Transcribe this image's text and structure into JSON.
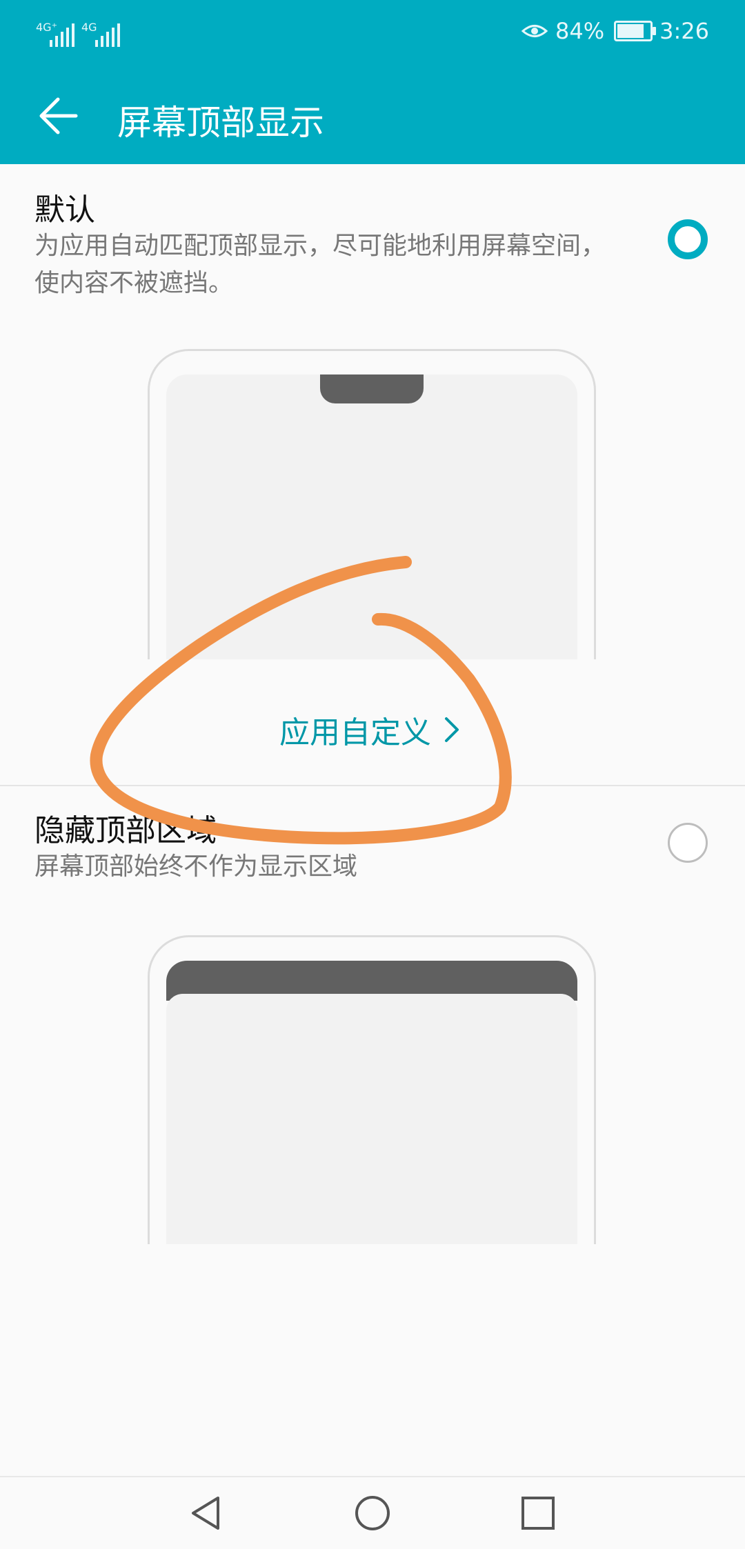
{
  "status_bar": {
    "network_1": "4G⁺",
    "network_2": "4G",
    "battery_percent": "84%",
    "battery_level": 0.84,
    "time": "3:26",
    "icons": [
      "eye-comfort-icon",
      "battery-icon"
    ]
  },
  "header": {
    "title": "屏幕顶部显示",
    "back_icon": "back-arrow-icon"
  },
  "options": [
    {
      "title": "默认",
      "description": "为应用自动匹配顶部显示，尽可能地利用屏幕空间，使内容不被遮挡。",
      "selected": true
    },
    {
      "title": "隐藏顶部区域",
      "description": "屏幕顶部始终不作为显示区域",
      "selected": false
    }
  ],
  "app_custom_link": {
    "label": "应用自定义",
    "icon": "chevron-right-icon"
  },
  "colors": {
    "accent": "#00acc1",
    "annotation": "#f0924a"
  },
  "nav_bar": [
    "back-triangle-icon",
    "home-circle-icon",
    "recents-square-icon"
  ]
}
